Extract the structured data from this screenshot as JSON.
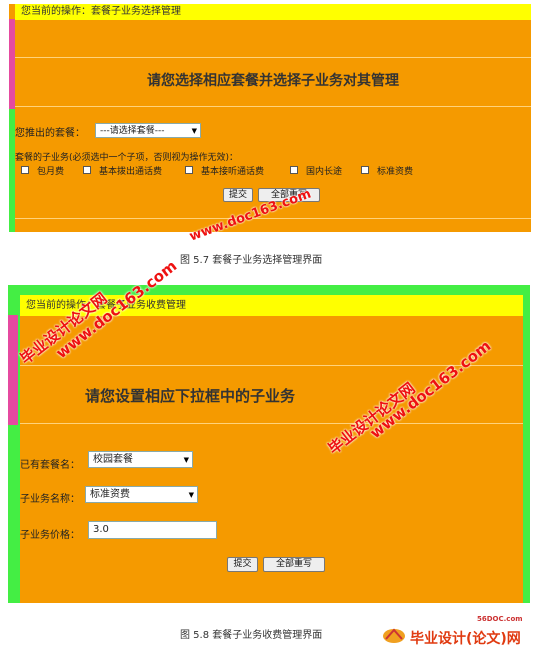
{
  "screen1": {
    "breadcrumb": "您当前的操作：套餐子业务选择管理",
    "heading": "请您选择相应套餐并选择子业务对其管理",
    "package_label": "您推出的套餐：",
    "package_select": "---请选择套餐---",
    "subservice_label": "套餐的子业务(必须选中一个子项，否则视为操作无效)：",
    "checkboxes": [
      "包月费",
      "基本拨出通话费",
      "基本接听通话费",
      "国内长途",
      "标准资费"
    ],
    "submit": "提交",
    "reset": "全部重写"
  },
  "caption1": "图 5.7 套餐子业务选择管理界面",
  "screen2": {
    "breadcrumb": "您当前的操作：套餐子业务收费管理",
    "heading": "请您设置相应下拉框中的子业务",
    "existing_label": "已有套餐名：",
    "existing_select": "校园套餐",
    "subname_label": "子业务名称：",
    "subname_select": "标准资费",
    "price_label": "子业务价格：",
    "price_value": "3.0",
    "submit": "提交",
    "reset": "全部重写"
  },
  "caption2": "图 5.8  套餐子业务收费管理界面",
  "watermarks": {
    "cn": "毕业设计论文网",
    "url": "www.doc163.com",
    "footer_small": "56DOC.com",
    "footer_brand": "毕业设计(论文)网"
  },
  "colors": {
    "panel": "#f59a00",
    "breadcrumb": "#ffff00",
    "sidebar_top": "#e54aa0",
    "sidebar_bottom": "#44ee44"
  }
}
